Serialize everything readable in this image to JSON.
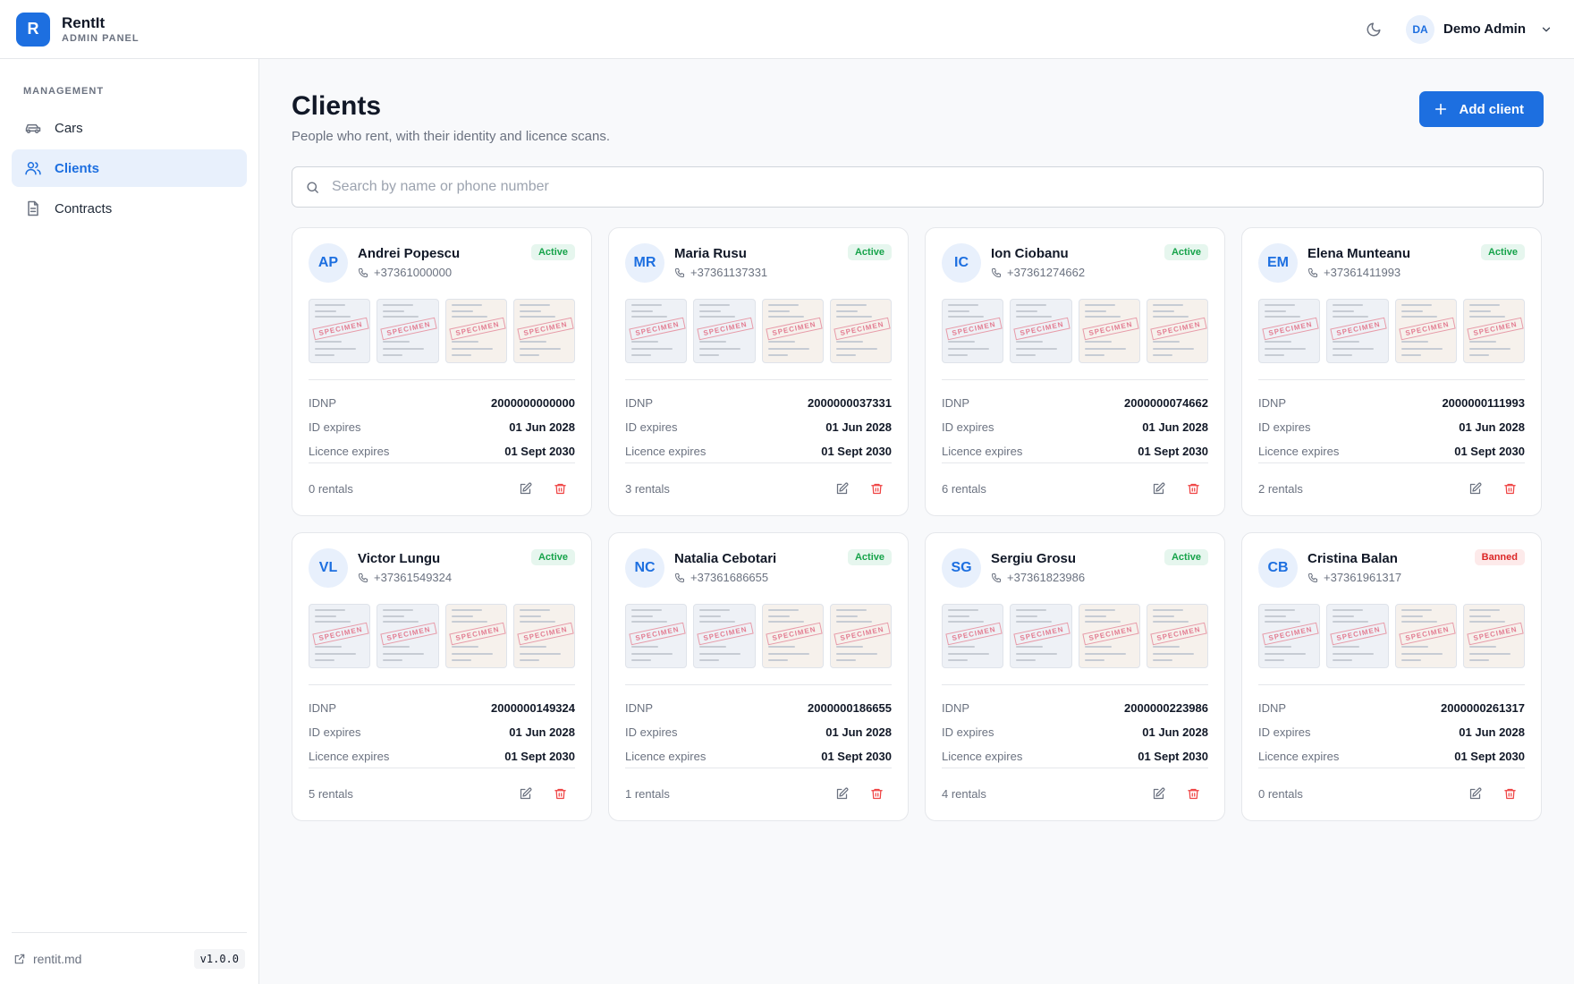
{
  "app": {
    "logo_letter": "R",
    "name": "RentIt",
    "subtitle": "ADMIN PANEL"
  },
  "header": {
    "user_initials": "DA",
    "user_name": "Demo Admin"
  },
  "sidebar": {
    "section_label": "MANAGEMENT",
    "items": [
      {
        "label": "Cars",
        "icon": "car-icon"
      },
      {
        "label": "Clients",
        "icon": "users-icon",
        "active": true
      },
      {
        "label": "Contracts",
        "icon": "document-icon"
      }
    ],
    "footer_link": "rentit.md",
    "version": "v1.0.0"
  },
  "page": {
    "title": "Clients",
    "subtitle": "People who rent, with their identity and licence scans.",
    "add_button": "Add client",
    "search_placeholder": "Search by name or phone number"
  },
  "labels": {
    "idnp": "IDNP",
    "id_expires": "ID expires",
    "licence_expires": "Licence expires",
    "scan_stamp": "SPECIMEN"
  },
  "clients": [
    {
      "initials": "AP",
      "name": "Andrei Popescu",
      "phone": "+37361000000",
      "status": "Active",
      "idnp": "2000000000000",
      "id_expires": "01 Jun 2028",
      "licence_expires": "01 Sept 2030",
      "rentals": "0 rentals"
    },
    {
      "initials": "MR",
      "name": "Maria Rusu",
      "phone": "+37361137331",
      "status": "Active",
      "idnp": "2000000037331",
      "id_expires": "01 Jun 2028",
      "licence_expires": "01 Sept 2030",
      "rentals": "3 rentals"
    },
    {
      "initials": "IC",
      "name": "Ion Ciobanu",
      "phone": "+37361274662",
      "status": "Active",
      "idnp": "2000000074662",
      "id_expires": "01 Jun 2028",
      "licence_expires": "01 Sept 2030",
      "rentals": "6 rentals"
    },
    {
      "initials": "EM",
      "name": "Elena Munteanu",
      "phone": "+37361411993",
      "status": "Active",
      "idnp": "2000000111993",
      "id_expires": "01 Jun 2028",
      "licence_expires": "01 Sept 2030",
      "rentals": "2 rentals"
    },
    {
      "initials": "VL",
      "name": "Victor Lungu",
      "phone": "+37361549324",
      "status": "Active",
      "idnp": "2000000149324",
      "id_expires": "01 Jun 2028",
      "licence_expires": "01 Sept 2030",
      "rentals": "5 rentals"
    },
    {
      "initials": "NC",
      "name": "Natalia Cebotari",
      "phone": "+37361686655",
      "status": "Active",
      "idnp": "2000000186655",
      "id_expires": "01 Jun 2028",
      "licence_expires": "01 Sept 2030",
      "rentals": "1 rentals"
    },
    {
      "initials": "SG",
      "name": "Sergiu Grosu",
      "phone": "+37361823986",
      "status": "Active",
      "idnp": "2000000223986",
      "id_expires": "01 Jun 2028",
      "licence_expires": "01 Sept 2030",
      "rentals": "4 rentals"
    },
    {
      "initials": "CB",
      "name": "Cristina Balan",
      "phone": "+37361961317",
      "status": "Banned",
      "idnp": "2000000261317",
      "id_expires": "01 Jun 2028",
      "licence_expires": "01 Sept 2030",
      "rentals": "0 rentals"
    }
  ],
  "colors": {
    "accent": "#1d6fe0",
    "active_badge": "#16a34a",
    "banned_badge": "#dc2626",
    "delete_icon": "#ef4444"
  }
}
